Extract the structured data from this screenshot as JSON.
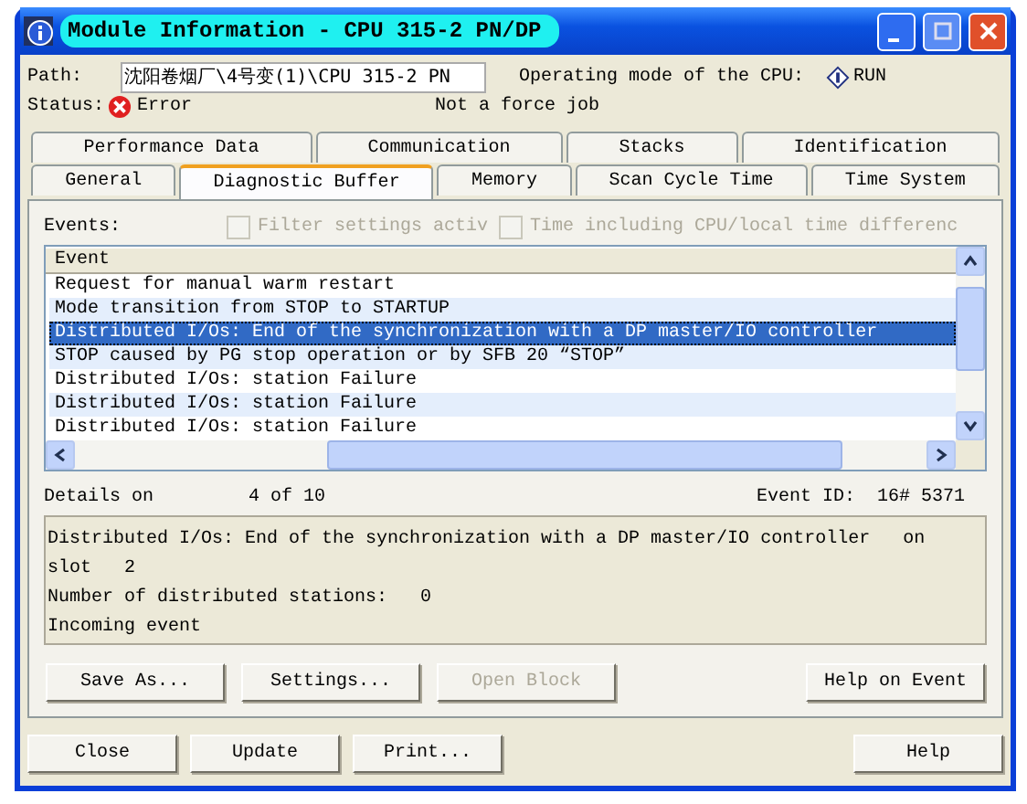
{
  "window": {
    "title": "Module Information - CPU 315-2 PN/DP"
  },
  "path": {
    "label": "Path:",
    "value": "沈阳卷烟厂\\4号变(1)\\CPU 315-2 PN"
  },
  "mode": {
    "label": "Operating mode of the  CPU:",
    "value": "RUN"
  },
  "status": {
    "label": "Status:",
    "value": "Error"
  },
  "force": {
    "text": "Not a force job"
  },
  "tabs": [
    [
      {
        "label": "Performance Data",
        "selected": false
      },
      {
        "label": "Communication",
        "selected": false
      },
      {
        "label": "Stacks",
        "selected": false
      },
      {
        "label": "Identification",
        "selected": false
      }
    ],
    [
      {
        "label": "General",
        "selected": false
      },
      {
        "label": "Diagnostic Buffer",
        "selected": true
      },
      {
        "label": "Memory",
        "selected": false
      },
      {
        "label": "Scan Cycle Time",
        "selected": false
      },
      {
        "label": "Time System",
        "selected": false
      }
    ]
  ],
  "events": {
    "label": "Events:",
    "options": [
      {
        "label": "Filter settings activ",
        "checked": false,
        "disabled": true
      },
      {
        "label": "Time including CPU/local time differenc",
        "checked": false,
        "disabled": true
      }
    ],
    "column": "Event",
    "rows": [
      {
        "text": "Request for manual warm restart",
        "selected": false
      },
      {
        "text": "Mode transition from STOP to STARTUP",
        "selected": false
      },
      {
        "text": "Distributed I/Os: End of the synchronization with a DP master/IO controller",
        "selected": true
      },
      {
        "text": "STOP caused by PG stop operation or by SFB 20 “STOP”",
        "selected": false
      },
      {
        "text": "Distributed I/Os: station Failure",
        "selected": false
      },
      {
        "text": "Distributed I/Os: station Failure",
        "selected": false
      },
      {
        "text": "Distributed I/Os: station Failure",
        "selected": false
      }
    ]
  },
  "details": {
    "label": "Details on",
    "position": "4 of 10",
    "id_label": "Event ID:",
    "id": "16# 5371",
    "lines": [
      "Distributed I/Os: End of the synchronization with a DP master/IO controller   on slot   2",
      "Number of distributed stations:   0",
      "Incoming event"
    ]
  },
  "panel_buttons": [
    {
      "label": "Save As...",
      "disabled": false
    },
    {
      "label": "Settings...",
      "disabled": false
    },
    {
      "label": "Open Block",
      "disabled": true
    },
    {
      "label": "Help on Event",
      "disabled": false
    }
  ],
  "footer_buttons": [
    {
      "label": "Close"
    },
    {
      "label": "Update"
    },
    {
      "label": "Print..."
    },
    {
      "label": "Help"
    }
  ]
}
